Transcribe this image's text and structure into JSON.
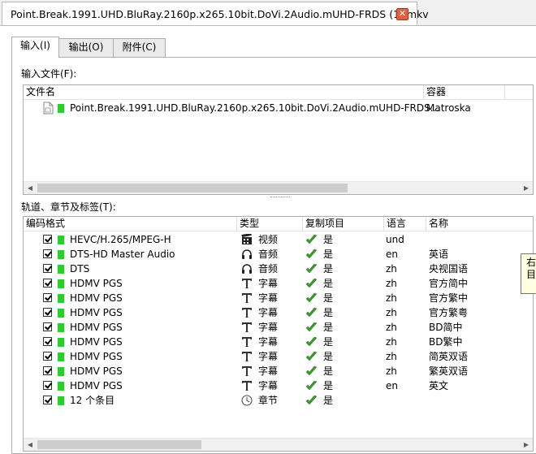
{
  "window": {
    "tab_title": "Point.Break.1991.UHD.BluRay.2160p.x265.10bit.DoVi.2Audio.mUHD-FRDS (1).mkv",
    "close_glyph": "✕"
  },
  "subtabs": [
    {
      "label": "输入(I)",
      "active": true
    },
    {
      "label": "输出(O)",
      "active": false
    },
    {
      "label": "附件(C)",
      "active": false
    }
  ],
  "input_files": {
    "label": "输入文件(F):",
    "columns": [
      "文件名",
      "容器"
    ],
    "rows": [
      {
        "filename": "Point.Break.1991.UHD.BluRay.2160p.x265.10bit.DoVi.2Audio.mUHD-FRDS...",
        "container": "Matroska",
        "icon": "file-icon"
      }
    ]
  },
  "tracks": {
    "label": "轨道、章节及标签(T):",
    "columns": [
      "编码格式",
      "类型",
      "复制项目",
      "语言",
      "名称"
    ],
    "rows": [
      {
        "codec": "HEVC/H.265/MPEG-H",
        "type_icon": "video-icon",
        "type": "视频",
        "copy": "是",
        "lang": "und",
        "name": ""
      },
      {
        "codec": "DTS-HD Master Audio",
        "type_icon": "audio-icon",
        "type": "音频",
        "copy": "是",
        "lang": "en",
        "name": "英语"
      },
      {
        "codec": "DTS",
        "type_icon": "audio-icon",
        "type": "音频",
        "copy": "是",
        "lang": "zh",
        "name": "央视国语"
      },
      {
        "codec": "HDMV PGS",
        "type_icon": "subtitle-icon",
        "type": "字幕",
        "copy": "是",
        "lang": "zh",
        "name": "官方简中"
      },
      {
        "codec": "HDMV PGS",
        "type_icon": "subtitle-icon",
        "type": "字幕",
        "copy": "是",
        "lang": "zh",
        "name": "官方繁中"
      },
      {
        "codec": "HDMV PGS",
        "type_icon": "subtitle-icon",
        "type": "字幕",
        "copy": "是",
        "lang": "zh",
        "name": "官方繁粤"
      },
      {
        "codec": "HDMV PGS",
        "type_icon": "subtitle-icon",
        "type": "字幕",
        "copy": "是",
        "lang": "zh",
        "name": "BD简中"
      },
      {
        "codec": "HDMV PGS",
        "type_icon": "subtitle-icon",
        "type": "字幕",
        "copy": "是",
        "lang": "zh",
        "name": "BD繁中"
      },
      {
        "codec": "HDMV PGS",
        "type_icon": "subtitle-icon",
        "type": "字幕",
        "copy": "是",
        "lang": "zh",
        "name": "简英双语"
      },
      {
        "codec": "HDMV PGS",
        "type_icon": "subtitle-icon",
        "type": "字幕",
        "copy": "是",
        "lang": "zh",
        "name": "繁英双语"
      },
      {
        "codec": "HDMV PGS",
        "type_icon": "subtitle-icon",
        "type": "字幕",
        "copy": "是",
        "lang": "en",
        "name": "英文"
      },
      {
        "codec": "12 个条目",
        "type_icon": "chapter-icon",
        "type": "章节",
        "copy": "是",
        "lang": "",
        "name": ""
      }
    ]
  },
  "tooltip": {
    "line1": "右",
    "line2": "目"
  },
  "colors": {
    "track_marker": "#22d322",
    "close_button": "#e0603f",
    "tick": "#3a9a2a"
  }
}
